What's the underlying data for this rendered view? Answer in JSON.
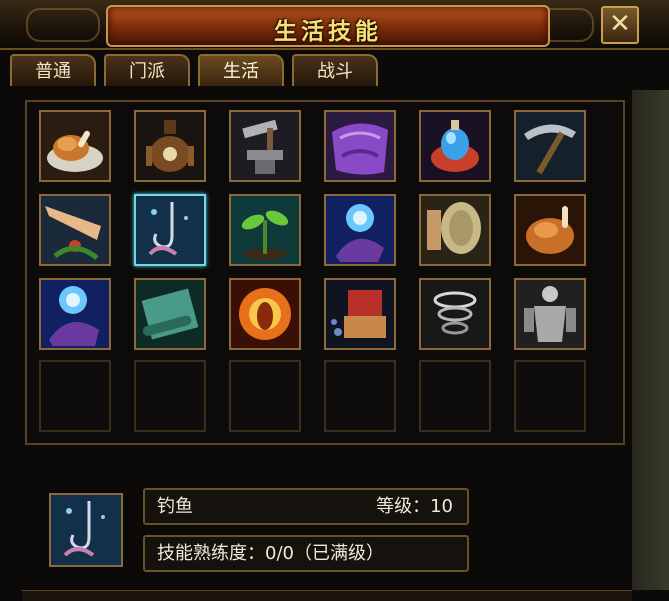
{
  "window": {
    "title": "生活技能",
    "close_label": "✕"
  },
  "tabs": [
    {
      "label": "普通",
      "active": false
    },
    {
      "label": "门派",
      "active": false
    },
    {
      "label": "生活",
      "active": true
    },
    {
      "label": "战斗",
      "active": false
    }
  ],
  "skills": [
    {
      "icon": "roast-drumstick-icon"
    },
    {
      "icon": "alchemy-vessel-icon"
    },
    {
      "icon": "anvil-hammer-icon"
    },
    {
      "icon": "purple-cloth-icon"
    },
    {
      "icon": "potion-flask-icon"
    },
    {
      "icon": "pickaxe-icon"
    },
    {
      "icon": "herb-gathering-icon"
    },
    {
      "icon": "fishing-hook-icon",
      "selected": true
    },
    {
      "icon": "sprout-icon"
    },
    {
      "icon": "blue-magic-hand-icon"
    },
    {
      "icon": "gong-drum-icon"
    },
    {
      "icon": "roast-chicken-icon"
    },
    {
      "icon": "blue-magic-hand-icon"
    },
    {
      "icon": "scroll-icon"
    },
    {
      "icon": "fire-aura-icon"
    },
    {
      "icon": "book-craft-icon"
    },
    {
      "icon": "whirlwind-icon"
    },
    {
      "icon": "statue-figure-icon"
    }
  ],
  "empty_slots": 6,
  "selected_skill": {
    "icon": "fishing-hook-icon",
    "name": "钓鱼",
    "level_text": "等级：10",
    "proficiency_text": "技能熟练度：0/0（已满级）"
  },
  "colors": {
    "title_text": "#f8e070",
    "frame": "#8a6a3a",
    "selected_border": "#6fd8e8"
  }
}
